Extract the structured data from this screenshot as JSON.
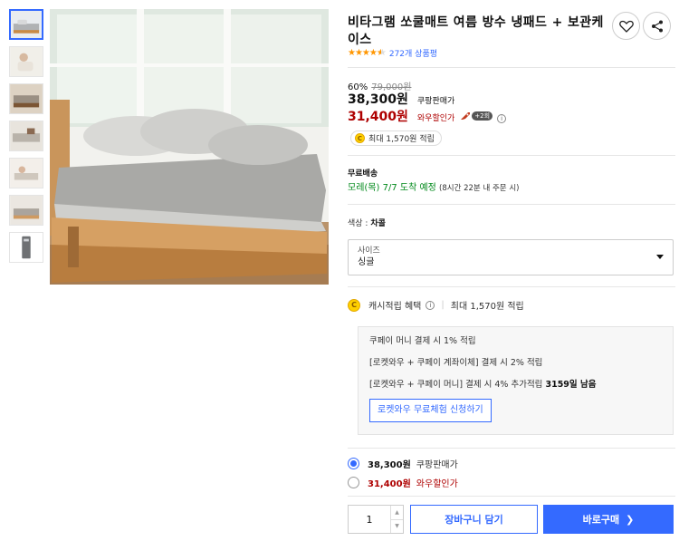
{
  "product": {
    "title": "비타그램 쏘쿨매트 여름 방수 냉패드 + 보관케이스",
    "review_count": "272개 상품평",
    "rating_stars": 4.5
  },
  "icons": {
    "wishlist": "heart-icon",
    "share": "share-icon",
    "info": "info-icon",
    "coin": "coin-icon",
    "rocket": "rocket-icon",
    "chevron": "chevron-right-icon",
    "caret": "caret-down-icon"
  },
  "pricing": {
    "discount_rate": "60%",
    "original_price": "79,000원",
    "coupang_price": "38,300원",
    "coupang_label": "쿠팡판매가",
    "wow_price": "31,400원",
    "wow_label": "와우할인가",
    "rocket_count": "+2회",
    "cash_badge": "최대 1,570원 적립"
  },
  "shipping": {
    "label": "무료배송",
    "arrival": "모레(목) 7/7",
    "arrival_suffix": "도착 예정",
    "note": "(8시간 22분 내 주문 시)"
  },
  "options": {
    "color_label": "색상 :",
    "color_value": "차콜",
    "size_label": "사이즈",
    "size_value": "싱글"
  },
  "cash_benefit": {
    "label": "캐시적립 혜택",
    "max": "최대 1,570원 적립",
    "line1": "쿠페이 머니 결제 시 1% 적립",
    "line2": "[로켓와우 + 쿠페이 계좌이체] 결제 시 2% 적립",
    "line3_prefix": "[로켓와우 + 쿠페이 머니] 결제 시 4% 추가적립",
    "line3_bold": "3159일 남음",
    "trial_button": "로켓와우 무료체험 신청하기"
  },
  "price_choice": [
    {
      "price": "38,300원",
      "label": "쿠팡판매가",
      "selected": true
    },
    {
      "price": "31,400원",
      "label": "와우할인가",
      "selected": false
    }
  ],
  "purchase": {
    "quantity": "1",
    "cart_button": "장바구니 담기",
    "buy_button": "바로구매"
  },
  "colors": {
    "accent": "#346aff",
    "sale_red": "#ae0000",
    "star_orange": "#ff9600",
    "delivery_green": "#00891a"
  }
}
